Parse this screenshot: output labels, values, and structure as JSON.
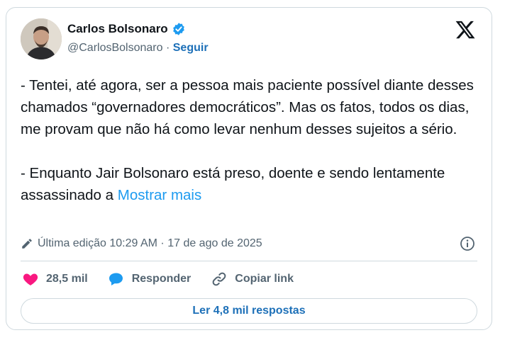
{
  "author": {
    "name": "Carlos Bolsonaro",
    "handle": "@CarlosBolsonaro",
    "separator": " · ",
    "follow_label": "Seguir"
  },
  "icons": {
    "verified": "verified-badge-icon",
    "x_logo": "x-logo-icon",
    "edit": "pencil-icon",
    "info": "info-icon",
    "like": "heart-icon",
    "reply": "speech-bubble-icon",
    "copy": "link-icon"
  },
  "colors": {
    "accent": "#1d9bf0",
    "link": "#1d70b8",
    "heart": "#f91880",
    "muted": "#536471"
  },
  "tweet": {
    "text": "- Tentei, até agora, ser a pessoa mais paciente possível diante desses chamados “governadores democráticos”. Mas os fatos, todos os dias, me provam que não há como levar nenhum desses sujeitos a sério.\n\n- Enquanto Jair Bolsonaro está preso, doente e sendo lentamente assassinado a ",
    "show_more": "Mostrar mais",
    "edited_label": "Última edição 10:29 AM · 17 de ago de 2025"
  },
  "actions": {
    "likes": "28,5 mil",
    "reply_label": "Responder",
    "copy_label": "Copiar link",
    "read_replies": "Ler 4,8 mil respostas"
  }
}
